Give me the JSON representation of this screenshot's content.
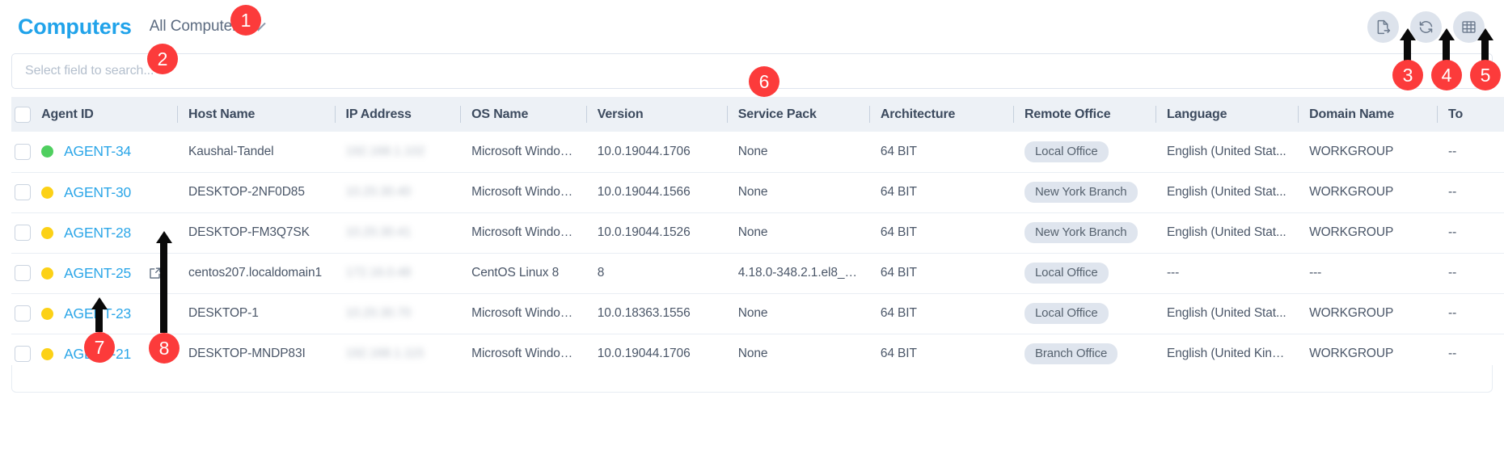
{
  "header": {
    "title": "Computers",
    "scope_label": "All Computers",
    "chevron_icon": "chevron-down-icon",
    "actions": [
      {
        "name": "export-icon",
        "label": "Export"
      },
      {
        "name": "refresh-icon",
        "label": "Refresh"
      },
      {
        "name": "table-columns-icon",
        "label": "Columns"
      }
    ]
  },
  "search": {
    "placeholder": "Select field to search...",
    "value": ""
  },
  "table": {
    "columns": [
      "Agent ID",
      "Host Name",
      "IP Address",
      "OS Name",
      "Version",
      "Service Pack",
      "Architecture",
      "Remote Office",
      "Language",
      "Domain Name",
      "To"
    ],
    "rows": [
      {
        "selected": true,
        "status_color": "#4fcf5f",
        "agent_id": "AGENT-34",
        "has_external_link": false,
        "host_name": "Kaushal-Tandel",
        "ip_address": "192.168.1.102",
        "os_name": "Microsoft Windows 10...",
        "version": "10.0.19044.1706",
        "service_pack": "None",
        "architecture": "64 BIT",
        "remote_office": "Local Office",
        "language": "English (United Stat...",
        "domain_name": "WORKGROUP",
        "to": "--"
      },
      {
        "selected": false,
        "status_color": "#fcd116",
        "agent_id": "AGENT-30",
        "has_external_link": false,
        "host_name": "DESKTOP-2NF0D85",
        "ip_address": "10.20.30.40",
        "os_name": "Microsoft Windows 10...",
        "version": "10.0.19044.1566",
        "service_pack": "None",
        "architecture": "64 BIT",
        "remote_office": "New York Branch",
        "language": "English (United Stat...",
        "domain_name": "WORKGROUP",
        "to": "--"
      },
      {
        "selected": false,
        "status_color": "#fcd116",
        "agent_id": "AGENT-28",
        "has_external_link": false,
        "host_name": "DESKTOP-FM3Q7SK",
        "ip_address": "10.20.30.41",
        "os_name": "Microsoft Windows 10...",
        "version": "10.0.19044.1526",
        "service_pack": "None",
        "architecture": "64 BIT",
        "remote_office": "New York Branch",
        "language": "English (United Stat...",
        "domain_name": "WORKGROUP",
        "to": "--"
      },
      {
        "selected": false,
        "status_color": "#fcd116",
        "agent_id": "AGENT-25",
        "has_external_link": true,
        "host_name": "centos207.localdomain1",
        "ip_address": "172.16.0.48",
        "os_name": "CentOS Linux 8",
        "version": "8",
        "service_pack": "4.18.0-348.2.1.el8_5....",
        "architecture": "64 BIT",
        "remote_office": "Local Office",
        "language": "---",
        "domain_name": "---",
        "to": "--"
      },
      {
        "selected": false,
        "status_color": "#fcd116",
        "agent_id": "AGENT-23",
        "has_external_link": false,
        "host_name": "DESKTOP-1",
        "ip_address": "10.20.30.70",
        "os_name": "Microsoft Windows 10...",
        "version": "10.0.18363.1556",
        "service_pack": "None",
        "architecture": "64 BIT",
        "remote_office": "Local Office",
        "language": "English (United Stat...",
        "domain_name": "WORKGROUP",
        "to": "--"
      },
      {
        "selected": false,
        "status_color": "#fcd116",
        "agent_id": "AGENT-21",
        "has_external_link": false,
        "host_name": "DESKTOP-MNDP83I",
        "ip_address": "192.168.1.115",
        "os_name": "Microsoft Windows 10...",
        "version": "10.0.19044.1706",
        "service_pack": "None",
        "architecture": "64 BIT",
        "remote_office": "Branch Office",
        "language": "English (United King...",
        "domain_name": "WORKGROUP",
        "to": "--"
      }
    ]
  },
  "annotations": {
    "markers": [
      {
        "label": "1"
      },
      {
        "label": "2"
      },
      {
        "label": "3"
      },
      {
        "label": "4"
      },
      {
        "label": "5"
      },
      {
        "label": "6"
      },
      {
        "label": "7"
      },
      {
        "label": "8"
      }
    ]
  },
  "colors": {
    "accent": "#21a3ea",
    "link": "#2ba6e8",
    "marker": "#fc3b3b",
    "online": "#4fcf5f",
    "idle": "#fcd116",
    "header_bg": "#edf1f6",
    "pill_bg": "#dfe5ee"
  }
}
